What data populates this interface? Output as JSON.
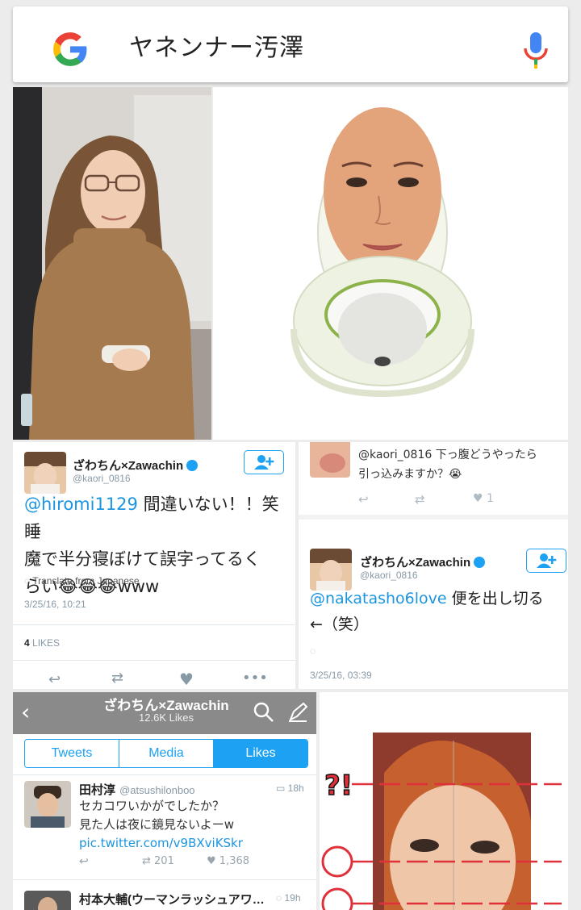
{
  "search": {
    "query": "ヤネンナー汚澤"
  },
  "icons": {
    "logo": "google-g-icon",
    "mic": "mic-icon"
  },
  "tweet_a": {
    "name": "ざわちん×Zawachin",
    "handle": "@kaori_0816",
    "mention": "@hiromi1129",
    "text1": " 間違いない！！笑 睡",
    "text2": "魔で半分寝ぼけて誤字ってるく",
    "text3": "らい😂😂😂www",
    "translate": "Translate from Japanese",
    "timestamp": "3/25/16, 10:21",
    "likes_count": "4",
    "likes_label": "LIKES"
  },
  "tweet_b_top": {
    "text1": "@kaori_0816 下っ腹どうやったら",
    "text2": "引っ込みますか？😭",
    "like_count": "1"
  },
  "tweet_b": {
    "name": "ざわちん×Zawachin",
    "handle": "@kaori_0816",
    "mention": "@nakatasho6love",
    "text1": " 便を出し切る",
    "text2": "←（笑）",
    "timestamp": "3/25/16, 03:39"
  },
  "likes_screen": {
    "title": "ざわちん×Zawachin",
    "subtitle": "12.6K Likes",
    "tabs": [
      "Tweets",
      "Media",
      "Likes"
    ],
    "item1": {
      "name": "田村淳",
      "handle": "@atsushilonboo",
      "time": "18h",
      "line1": "セカコワいかがでしたか？",
      "line2": "見た人は夜に鏡見ないよーw",
      "link": "pic.twitter.com/v9BXviKSkr",
      "retweets": "201",
      "likes": "1,368"
    },
    "item2": {
      "name": "村本大輔(ウーマンラッシュアワ…",
      "time": "19h"
    }
  },
  "face_graphic": {
    "label": "?!"
  },
  "colors": {
    "twitter_blue": "#1da1f2",
    "mention_blue": "#1b95e0",
    "red_guide": "#e0303a"
  }
}
